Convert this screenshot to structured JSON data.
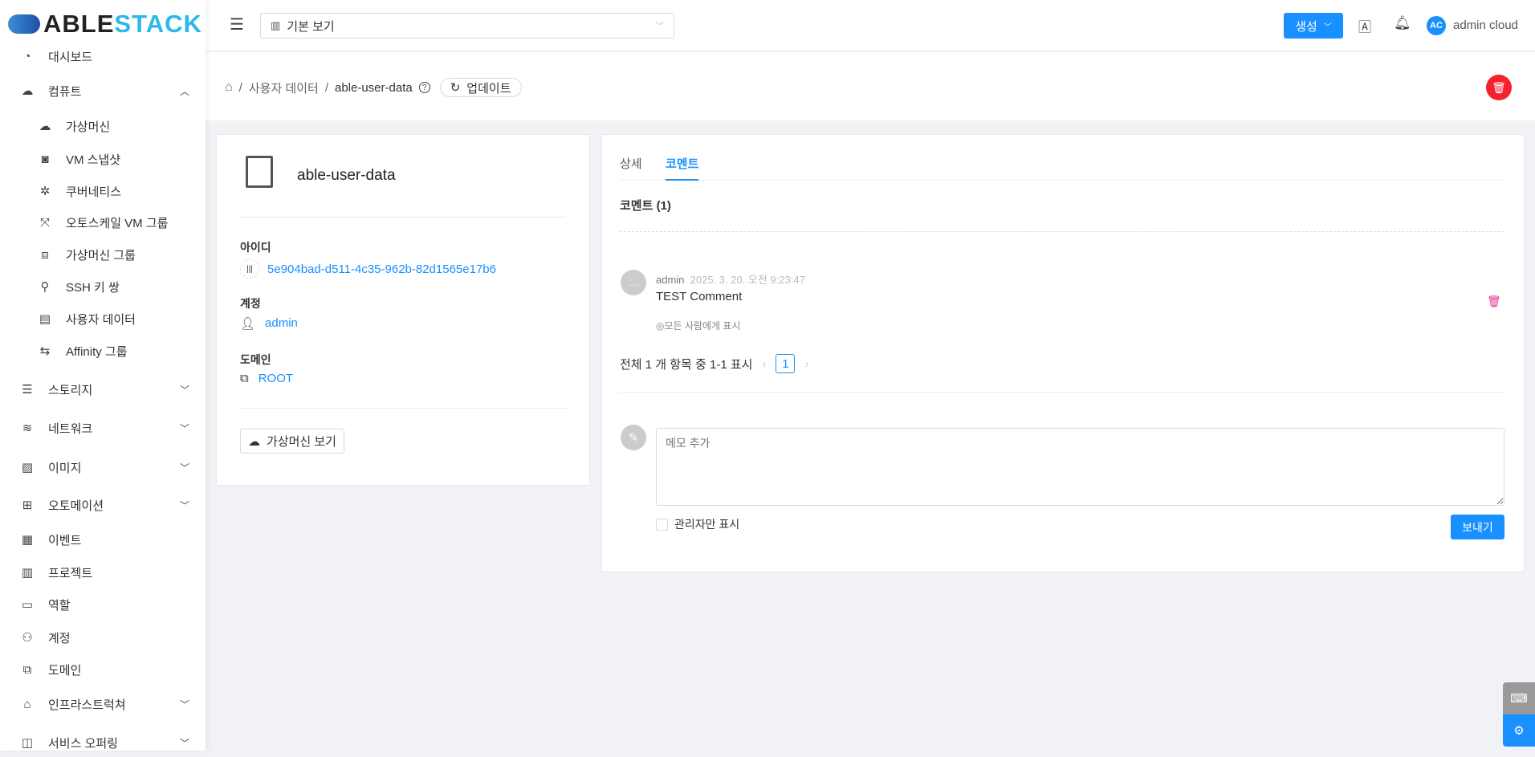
{
  "logo": {
    "part1": "ABLE",
    "part2": "STACK"
  },
  "sidebar": {
    "items": [
      {
        "label": "대시보드",
        "icon": "dashboard-icon"
      },
      {
        "label": "컴퓨트",
        "icon": "cloud-icon",
        "expanded": true
      },
      {
        "label": "가상머신",
        "icon": "vm-icon"
      },
      {
        "label": "VM 스냅샷",
        "icon": "camera-icon"
      },
      {
        "label": "쿠버네티스",
        "icon": "kubernetes-icon"
      },
      {
        "label": "오토스케일 VM 그룹",
        "icon": "autoscale-icon"
      },
      {
        "label": "가상머신 그룹",
        "icon": "cluster-icon"
      },
      {
        "label": "SSH 키 쌍",
        "icon": "key-icon"
      },
      {
        "label": "사용자 데이터",
        "icon": "user-data-icon"
      },
      {
        "label": "Affinity 그룹",
        "icon": "swap-icon"
      },
      {
        "label": "스토리지",
        "icon": "storage-icon"
      },
      {
        "label": "네트워크",
        "icon": "wifi-icon"
      },
      {
        "label": "이미지",
        "icon": "image-icon"
      },
      {
        "label": "오토메이션",
        "icon": "automation-icon"
      },
      {
        "label": "이벤트",
        "icon": "calendar-icon"
      },
      {
        "label": "프로젝트",
        "icon": "project-icon"
      },
      {
        "label": "역할",
        "icon": "id-card-icon"
      },
      {
        "label": "계정",
        "icon": "team-icon"
      },
      {
        "label": "도메인",
        "icon": "domain-icon"
      },
      {
        "label": "인프라스트럭쳐",
        "icon": "bank-icon"
      },
      {
        "label": "서비스 오퍼링",
        "icon": "shopping-icon"
      }
    ]
  },
  "header": {
    "view_select": "기본 보기",
    "create_label": "생성",
    "avatar_initials": "AC",
    "user_name": "admin cloud"
  },
  "breadcrumb": {
    "parent": "사용자 데이터",
    "current": "able-user-data",
    "refresh_label": "업데이트"
  },
  "info": {
    "title": "able-user-data",
    "id_label": "아이디",
    "id_value": "5e904bad-d511-4c35-962b-82d1565e17b6",
    "account_label": "계정",
    "account_value": "admin",
    "domain_label": "도메인",
    "domain_value": "ROOT",
    "view_vm_label": "가상머신 보기"
  },
  "tabs": [
    {
      "label": "상세"
    },
    {
      "label": "코멘트",
      "active": true
    }
  ],
  "comments": {
    "heading": "코멘트 (1)",
    "items": [
      {
        "author": "admin",
        "time": "2025. 3. 20. 오전 9:23:47",
        "text": "TEST Comment",
        "visibility": "모든 사람에게 표시"
      }
    ],
    "pagination_text": "전체 1 개 항목 중 1-1 표시",
    "current_page": "1",
    "input_placeholder": "메모 추가",
    "admin_only_label": "관리자만 표시",
    "send_label": "보내기"
  },
  "colors": {
    "accent": "#1890ff",
    "danger": "#f5222d"
  }
}
